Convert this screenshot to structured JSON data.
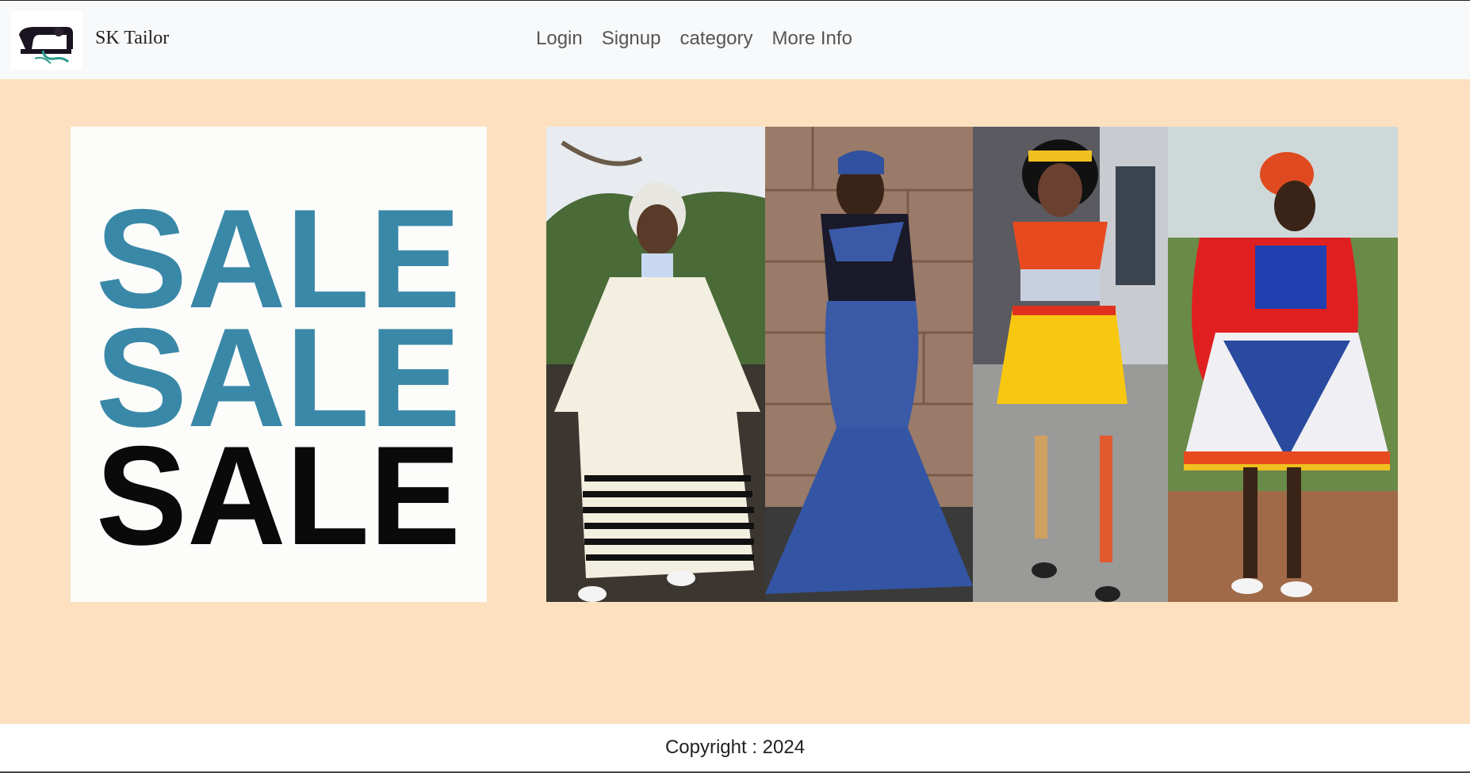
{
  "brand": {
    "name": "SK Tailor",
    "logo_icon": "sewing-machine-icon"
  },
  "nav": {
    "items": [
      {
        "label": "Login"
      },
      {
        "label": "Signup"
      },
      {
        "label": "category"
      },
      {
        "label": "More Info"
      }
    ]
  },
  "promo": {
    "lines": [
      "SALE",
      "SALE",
      "SALE"
    ],
    "colors": {
      "accent": "#3a88a8",
      "dark": "#0a0a0a"
    }
  },
  "gallery": {
    "images": [
      {
        "name": "white-striped-traditional-dress"
      },
      {
        "name": "blue-shweshwe-gown"
      },
      {
        "name": "yellow-beaded-zulu-attire"
      },
      {
        "name": "red-blue-ndebele-dress"
      }
    ]
  },
  "footer": {
    "copyright": "Copyright : 2024"
  },
  "colors": {
    "page_bg": "#fce0c0",
    "navbar_bg": "#f8f9fa"
  }
}
